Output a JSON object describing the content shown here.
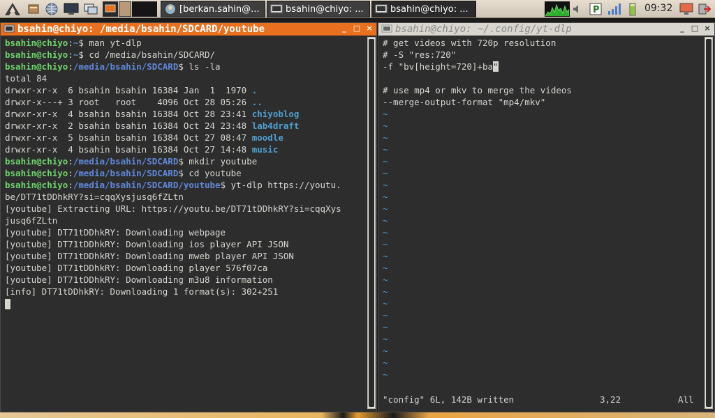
{
  "panel": {
    "tasks": [
      {
        "label": "[berkan.sahin@..."
      },
      {
        "label": "bsahin@chiyo: ..."
      },
      {
        "label": "bsahin@chiyo: ..."
      }
    ],
    "clock": "09:32"
  },
  "left_window": {
    "title": "bsahin@chiyo: /media/bsahin/SDCARD/youtube",
    "buttons": [
      "_",
      "□",
      "×"
    ],
    "lines": [
      {
        "user": "bsahin@chiyo",
        "path": "~",
        "cmd": "$ man yt-dlp"
      },
      {
        "user": "bsahin@chiyo",
        "path": "~",
        "cmd": "$ cd /media/bsahin/SDCARD/"
      },
      {
        "user": "bsahin@chiyo",
        "path": "/media/bsahin/SDCARD",
        "cmd": "$ ls -la"
      },
      {
        "text": "total 84"
      },
      {
        "text": "drwxr-xr-x  6 bsahin bsahin 16384 Jan  1  1970 ",
        "dir": "."
      },
      {
        "text": "drwxr-x---+ 3 root   root    4096 Oct 28 05:26 ",
        "dir": ".."
      },
      {
        "text": "drwxr-xr-x  4 bsahin bsahin 16384 Oct 28 23:41 ",
        "dir": "chiyoblog"
      },
      {
        "text": "drwxr-xr-x  2 bsahin bsahin 16384 Oct 24 23:48 ",
        "dir": "lab4draft"
      },
      {
        "text": "drwxr-xr-x  5 bsahin bsahin 16384 Oct 27 08:47 ",
        "dir": "moodle"
      },
      {
        "text": "drwxr-xr-x  4 bsahin bsahin 16384 Oct 27 14:48 ",
        "dir": "music"
      },
      {
        "user": "bsahin@chiyo",
        "path": "/media/bsahin/SDCARD",
        "cmd": "$ mkdir youtube"
      },
      {
        "user": "bsahin@chiyo",
        "path": "/media/bsahin/SDCARD",
        "cmd": "$ cd youtube"
      },
      {
        "user": "bsahin@chiyo",
        "path": "/media/bsahin/SDCARD/youtube",
        "cmd": "$ yt-dlp https://youtu."
      },
      {
        "text": "be/DT71tDDhkRY?si=cqqXysjusq6fZLtn"
      },
      {
        "text": "[youtube] Extracting URL: https://youtu.be/DT71tDDhkRY?si=cqqXys"
      },
      {
        "text": "jusq6fZLtn"
      },
      {
        "text": "[youtube] DT71tDDhkRY: Downloading webpage"
      },
      {
        "text": "[youtube] DT71tDDhkRY: Downloading ios player API JSON"
      },
      {
        "text": "[youtube] DT71tDDhkRY: Downloading mweb player API JSON"
      },
      {
        "text": "[youtube] DT71tDDhkRY: Downloading player 576f07ca"
      },
      {
        "text": "[youtube] DT71tDDhkRY: Downloading m3u8 information"
      },
      {
        "text": "[info] DT71tDDhkRY: Downloading 1 format(s): 302+251"
      }
    ]
  },
  "right_window": {
    "title": "bsahin@chiyo: ~/.config/yt-dlp",
    "buttons": [
      "_",
      "□",
      "×"
    ],
    "lines": [
      "# get videos with 720p resolution",
      "# -S \"res:720\"",
      "-f \"bv[height=720]+ba\"",
      "",
      "# use mp4 or mkv to merge the videos",
      "--merge-output-format \"mp4/mkv\""
    ],
    "tilde_count": 23,
    "tilde": "~",
    "status_message": "\"config\" 6L, 142B written",
    "cursor_pos": "3,22",
    "scroll_pos": "All"
  }
}
